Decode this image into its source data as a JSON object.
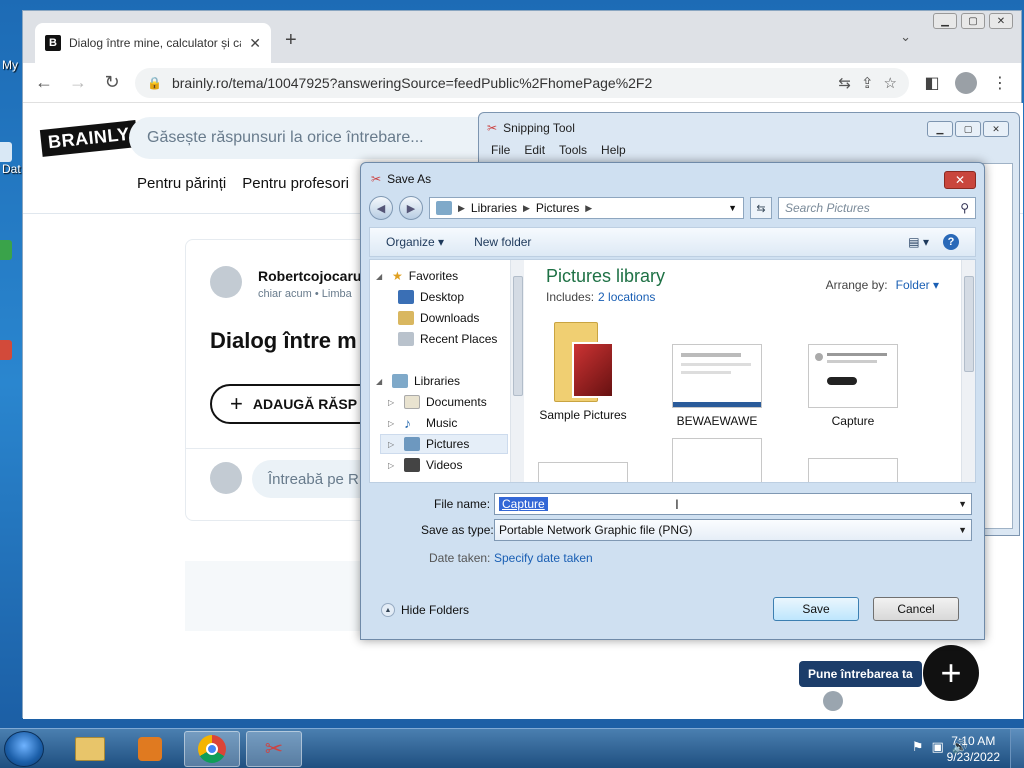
{
  "desktop": {
    "labels": [
      "My",
      "Dat"
    ]
  },
  "browser": {
    "tab_title": "Dialog între mine, calculator și ca",
    "tab_favicon": "B",
    "url": "brainly.ro/tema/10047925?answeringSource=feedPublic%2FhomePage%2F2"
  },
  "brainly": {
    "logo": "BRAINLY",
    "search_placeholder": "Găsește răspunsuri la orice întrebare...",
    "nav": [
      "Pentru părinți",
      "Pentru profesori"
    ],
    "author": "Robertcojocaru",
    "meta": "chiar acum • Limba",
    "question_title": "Dialog între m",
    "add_answer": "ADAUGĂ RĂSP",
    "ask_placeholder": "Întreabă pe R",
    "ask_button": "Pune întrebarea ta"
  },
  "snipping": {
    "title": "Snipping Tool",
    "menu": [
      "File",
      "Edit",
      "Tools",
      "Help"
    ]
  },
  "save_dialog": {
    "title": "Save As",
    "breadcrumb": [
      "Libraries",
      "Pictures"
    ],
    "search_placeholder": "Search Pictures",
    "organize": "Organize",
    "new_folder": "New folder",
    "tree": {
      "favorites": "Favorites",
      "desktop": "Desktop",
      "downloads": "Downloads",
      "recent": "Recent Places",
      "libraries": "Libraries",
      "documents": "Documents",
      "music": "Music",
      "pictures": "Pictures",
      "videos": "Videos"
    },
    "library_title": "Pictures library",
    "includes_label": "Includes:",
    "includes_link": "2 locations",
    "arrange_label": "Arrange by:",
    "arrange_value": "Folder",
    "items": [
      "Sample Pictures",
      "BEWAEWAWE",
      "Capture"
    ],
    "file_name_label": "File name:",
    "file_name_value": "Capture",
    "save_type_label": "Save as type:",
    "save_type_value": "Portable Network Graphic file (PNG)",
    "date_label": "Date taken:",
    "date_link": "Specify date taken",
    "hide_folders": "Hide Folders",
    "save": "Save",
    "cancel": "Cancel"
  },
  "taskbar": {
    "time": "7:10 AM",
    "date": "9/23/2022"
  }
}
